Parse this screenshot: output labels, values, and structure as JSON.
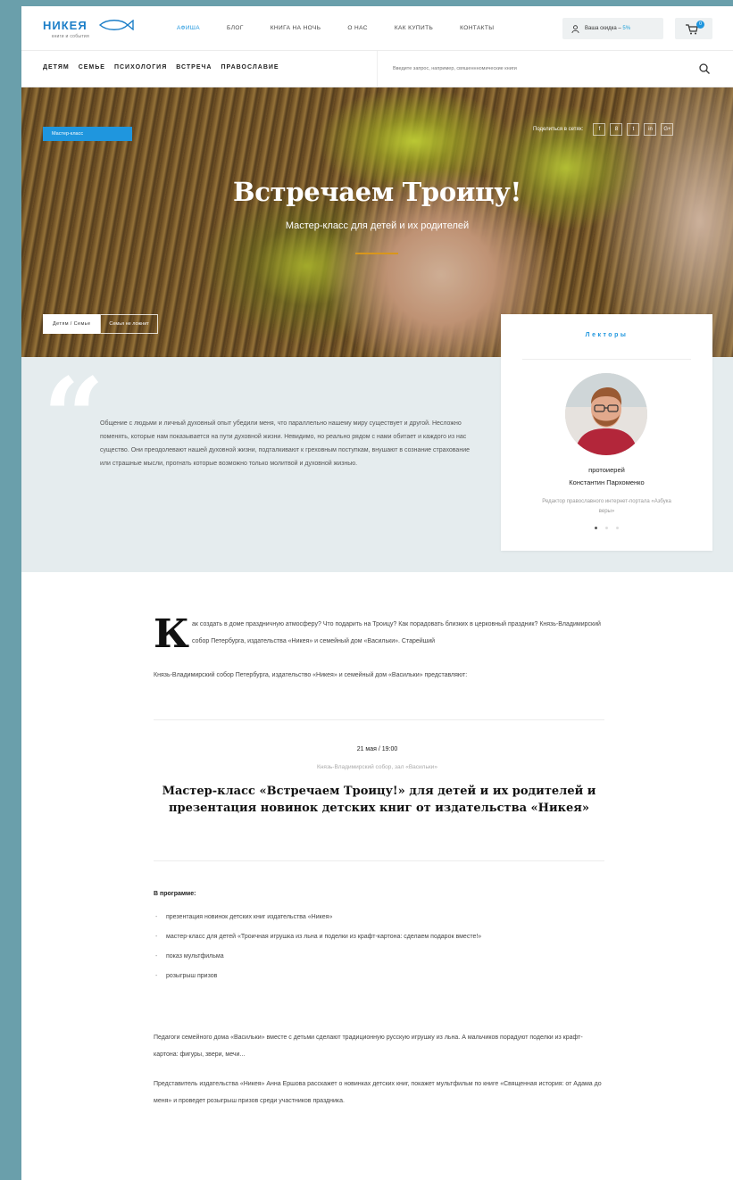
{
  "header": {
    "logo": {
      "word": "НИКЕЯ",
      "tagline": "книги и события"
    },
    "nav": [
      {
        "label": "Афиша",
        "active": true
      },
      {
        "label": "Блог",
        "active": false
      },
      {
        "label": "Книга на ночь",
        "active": false
      },
      {
        "label": "О нас",
        "active": false
      },
      {
        "label": "Как купить",
        "active": false
      },
      {
        "label": "Контакты",
        "active": false
      }
    ],
    "discount": {
      "label": "Ваша скидка –",
      "value": "5%"
    },
    "cart_count": "0"
  },
  "categories": [
    "Детям",
    "Семье",
    "Психология",
    "Встреча",
    "Православие"
  ],
  "search": {
    "placeholder": "Введите запрос, например, свяшеннномические книги"
  },
  "hero": {
    "tag": "Мастер-класс",
    "share_label": "Поделиться в сетях:",
    "share_icons": [
      "f",
      "8",
      "t",
      "in",
      "G+"
    ],
    "title": "Встречаем Троицу!",
    "subtitle": "Мастер-класс для детей и их родителей",
    "breadcrumb_1": "Детям / Семье",
    "breadcrumb_2": "Семья не ложнит",
    "accent_color": "#d9961b"
  },
  "quote": {
    "text": "Общение с людьми и личный духовный опыт убедили меня, что параллельно нашему миру существует и другой. Несложно поменять, которые нам показывается на пути духовной жизни. Невидимо, но реально рядом с нами обитает и каждого из нас существо. Они преодолевают нашей духовной жизни, подталкивают к греховным поступкам, внушают в сознание страхование или страшные мысли, прогнать которые возможно только молитвой и духовной жизнью."
  },
  "lecturers": {
    "title": "Лекторы",
    "role": "протоиерей",
    "name": "Константин Пархоменко",
    "desc": "Редактор православного интернет-портала «Азбука веры»"
  },
  "article": {
    "dropcap": "К",
    "intro_first": "ак создать в доме праздничную атмосферу? Что подарить на Троицу? Как порадовать близких в церковный праздник? Князь-Владимирский собор Петербурга, издательства «Никея» и семейный дом «Васильки». Старейший",
    "intro_rest": "Князь-Владимирский собор Петербурга, издательство «Никея» и семейный дом «Васильки» представляют:",
    "event_date": "21 мая / 19:00",
    "event_place": "Князь-Владимирский собор, зал «Васильки»",
    "event_title": "Мастер-класс «Встречаем Троицу!» для детей и их родителей и презентация новинок детских книг от издательства «Никея»",
    "program_title": "В программе:",
    "program": [
      "презентация новинок детских книг издательства «Никея»",
      "мастер-класс для детей «Троичная игрушка из льна и поделки из крафт-картона: сделаем подарок вместе!»",
      "показ мультфильма",
      "розыгрыш призов"
    ],
    "para1": "Педагоги семейного дома «Васильки» вместе с детьми сделают традиционную русскую игрушку из льна. А мальчиков порадуют поделки из крафт-картона: фигуры, звери, мечи...",
    "para2": "Представитель издательства «Никея» Анна Ершова расскажет о новинках детских книг, покажет мультфильм по книге «Священная история: от Адама до меня» и проведет розыгрыш призов среди участников праздника."
  }
}
